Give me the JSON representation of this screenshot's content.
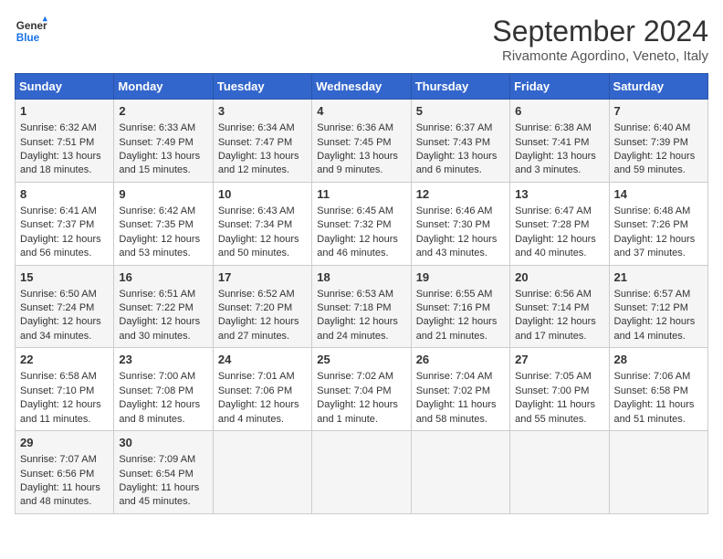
{
  "logo": {
    "line1": "General",
    "line2": "Blue"
  },
  "title": "September 2024",
  "location": "Rivamonte Agordino, Veneto, Italy",
  "weekdays": [
    "Sunday",
    "Monday",
    "Tuesday",
    "Wednesday",
    "Thursday",
    "Friday",
    "Saturday"
  ],
  "weeks": [
    [
      {
        "day": "1",
        "rise": "6:32 AM",
        "set": "7:51 PM",
        "daylight": "13 hours and 18 minutes."
      },
      {
        "day": "2",
        "rise": "6:33 AM",
        "set": "7:49 PM",
        "daylight": "13 hours and 15 minutes."
      },
      {
        "day": "3",
        "rise": "6:34 AM",
        "set": "7:47 PM",
        "daylight": "13 hours and 12 minutes."
      },
      {
        "day": "4",
        "rise": "6:36 AM",
        "set": "7:45 PM",
        "daylight": "13 hours and 9 minutes."
      },
      {
        "day": "5",
        "rise": "6:37 AM",
        "set": "7:43 PM",
        "daylight": "13 hours and 6 minutes."
      },
      {
        "day": "6",
        "rise": "6:38 AM",
        "set": "7:41 PM",
        "daylight": "13 hours and 3 minutes."
      },
      {
        "day": "7",
        "rise": "6:40 AM",
        "set": "7:39 PM",
        "daylight": "12 hours and 59 minutes."
      }
    ],
    [
      {
        "day": "8",
        "rise": "6:41 AM",
        "set": "7:37 PM",
        "daylight": "12 hours and 56 minutes."
      },
      {
        "day": "9",
        "rise": "6:42 AM",
        "set": "7:35 PM",
        "daylight": "12 hours and 53 minutes."
      },
      {
        "day": "10",
        "rise": "6:43 AM",
        "set": "7:34 PM",
        "daylight": "12 hours and 50 minutes."
      },
      {
        "day": "11",
        "rise": "6:45 AM",
        "set": "7:32 PM",
        "daylight": "12 hours and 46 minutes."
      },
      {
        "day": "12",
        "rise": "6:46 AM",
        "set": "7:30 PM",
        "daylight": "12 hours and 43 minutes."
      },
      {
        "day": "13",
        "rise": "6:47 AM",
        "set": "7:28 PM",
        "daylight": "12 hours and 40 minutes."
      },
      {
        "day": "14",
        "rise": "6:48 AM",
        "set": "7:26 PM",
        "daylight": "12 hours and 37 minutes."
      }
    ],
    [
      {
        "day": "15",
        "rise": "6:50 AM",
        "set": "7:24 PM",
        "daylight": "12 hours and 34 minutes."
      },
      {
        "day": "16",
        "rise": "6:51 AM",
        "set": "7:22 PM",
        "daylight": "12 hours and 30 minutes."
      },
      {
        "day": "17",
        "rise": "6:52 AM",
        "set": "7:20 PM",
        "daylight": "12 hours and 27 minutes."
      },
      {
        "day": "18",
        "rise": "6:53 AM",
        "set": "7:18 PM",
        "daylight": "12 hours and 24 minutes."
      },
      {
        "day": "19",
        "rise": "6:55 AM",
        "set": "7:16 PM",
        "daylight": "12 hours and 21 minutes."
      },
      {
        "day": "20",
        "rise": "6:56 AM",
        "set": "7:14 PM",
        "daylight": "12 hours and 17 minutes."
      },
      {
        "day": "21",
        "rise": "6:57 AM",
        "set": "7:12 PM",
        "daylight": "12 hours and 14 minutes."
      }
    ],
    [
      {
        "day": "22",
        "rise": "6:58 AM",
        "set": "7:10 PM",
        "daylight": "12 hours and 11 minutes."
      },
      {
        "day": "23",
        "rise": "7:00 AM",
        "set": "7:08 PM",
        "daylight": "12 hours and 8 minutes."
      },
      {
        "day": "24",
        "rise": "7:01 AM",
        "set": "7:06 PM",
        "daylight": "12 hours and 4 minutes."
      },
      {
        "day": "25",
        "rise": "7:02 AM",
        "set": "7:04 PM",
        "daylight": "12 hours and 1 minute."
      },
      {
        "day": "26",
        "rise": "7:04 AM",
        "set": "7:02 PM",
        "daylight": "11 hours and 58 minutes."
      },
      {
        "day": "27",
        "rise": "7:05 AM",
        "set": "7:00 PM",
        "daylight": "11 hours and 55 minutes."
      },
      {
        "day": "28",
        "rise": "7:06 AM",
        "set": "6:58 PM",
        "daylight": "11 hours and 51 minutes."
      }
    ],
    [
      {
        "day": "29",
        "rise": "7:07 AM",
        "set": "6:56 PM",
        "daylight": "11 hours and 48 minutes."
      },
      {
        "day": "30",
        "rise": "7:09 AM",
        "set": "6:54 PM",
        "daylight": "11 hours and 45 minutes."
      },
      null,
      null,
      null,
      null,
      null
    ]
  ],
  "labels": {
    "sunrise": "Sunrise:",
    "sunset": "Sunset:",
    "daylight": "Daylight:"
  }
}
